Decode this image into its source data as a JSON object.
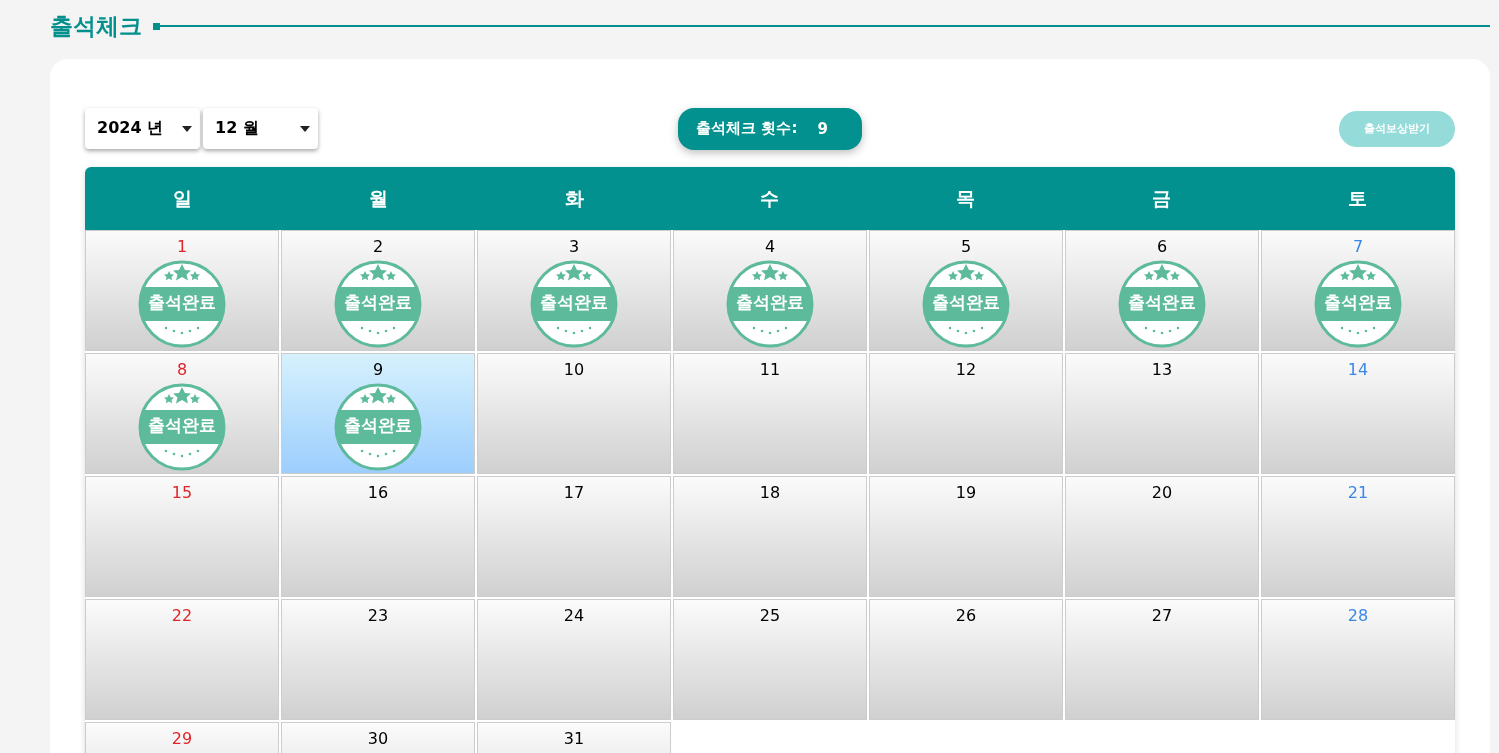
{
  "page_title": "출석체크",
  "filters": {
    "year": "2024 년",
    "month": "12 월"
  },
  "count": {
    "label": "출석체크 횟수:",
    "value": "9"
  },
  "reward_button": {
    "label": "출석보상받기",
    "disabled": true
  },
  "weekdays": [
    "일",
    "월",
    "화",
    "수",
    "목",
    "금",
    "토"
  ],
  "days": [
    {
      "day": "1",
      "stamp": "출석완료",
      "selected": false
    },
    {
      "day": "2",
      "stamp": "출석완료",
      "selected": false
    },
    {
      "day": "3",
      "stamp": "출석완료",
      "selected": false
    },
    {
      "day": "4",
      "stamp": "출석완료",
      "selected": false
    },
    {
      "day": "5",
      "stamp": "출석완료",
      "selected": false
    },
    {
      "day": "6",
      "stamp": "출석완료",
      "selected": false
    },
    {
      "day": "7",
      "stamp": "출석완료",
      "selected": false
    },
    {
      "day": "8",
      "stamp": "출석완료",
      "selected": false
    },
    {
      "day": "9",
      "stamp": "출석완료",
      "selected": true
    },
    {
      "day": "10",
      "selected": false
    },
    {
      "day": "11",
      "selected": false
    },
    {
      "day": "12",
      "selected": false
    },
    {
      "day": "13",
      "selected": false
    },
    {
      "day": "14",
      "selected": false
    },
    {
      "day": "15",
      "selected": false
    },
    {
      "day": "16",
      "selected": false
    },
    {
      "day": "17",
      "selected": false
    },
    {
      "day": "18",
      "selected": false
    },
    {
      "day": "19",
      "selected": false
    },
    {
      "day": "20",
      "selected": false
    },
    {
      "day": "21",
      "selected": false
    },
    {
      "day": "22",
      "selected": false
    },
    {
      "day": "23",
      "selected": false
    },
    {
      "day": "24",
      "selected": false
    },
    {
      "day": "25",
      "selected": false
    },
    {
      "day": "26",
      "selected": false
    },
    {
      "day": "27",
      "selected": false
    },
    {
      "day": "28",
      "selected": false
    },
    {
      "day": "29",
      "selected": false
    },
    {
      "day": "30",
      "selected": false
    },
    {
      "day": "31",
      "selected": false
    }
  ]
}
